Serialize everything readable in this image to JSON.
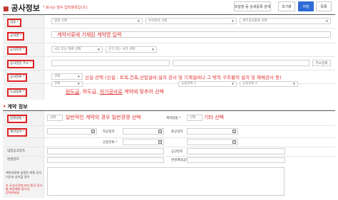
{
  "header": {
    "title": "공사정보",
    "required_note": "* 표시는 필수 입력항목입니다.",
    "buttons": {
      "search_prev": "조달청 등 상세등록 검색",
      "reset": "초기화",
      "save": "저장",
      "list": "목록"
    }
  },
  "construction": {
    "rows": {
      "work_type": {
        "label": "업종 *",
        "select": "업종 선택",
        "select2": "수의분야 선택",
        "select3": "세부공사종류 선택"
      },
      "name": {
        "label": "공사명 *",
        "annotation": "계약서류에 기재된 계약명 입력"
      },
      "location": {
        "label": "공사지역 *",
        "select": "시도 또는 대륙 선택",
        "select2": "군구 또는 국가 선택"
      },
      "address": {
        "label": "공사현장 주소 *",
        "search_btn": "주소검색"
      },
      "category": {
        "label": "공사분류 *",
        "select": "선택",
        "annotation": "신설 선택 (신설 : 토목,건축,산업설비,설치 공사 및 기계설비나 그 밖의 구조물의 설치 및 해체공사 등)"
      },
      "contract_kind": {
        "label": "도급종류 *",
        "select": "선택",
        "select2": "공종분류 1",
        "select3": "공종분류 2",
        "annotation_parts": [
          "원도급",
          ", 하도급, ",
          "자기공사로",
          " 계약에 맞추어 선택"
        ]
      }
    }
  },
  "contract": {
    "section_title": "계약 정보",
    "method": {
      "label": "입찰방법 *",
      "select": "선택",
      "annotation": "일반적인 계약의 경우 일반경쟁 선택"
    },
    "type": {
      "label": "계약방법 *",
      "select": "선택",
      "annotation": "기타 선택"
    },
    "rows": [
      {
        "left_label": "계약일자 *",
        "mid_label": "착공일자",
        "right_label": "준공일자"
      },
      {
        "left_label": "",
        "mid_label": "공종분류 *",
        "right_label": ""
      },
      {
        "left_label": "입찰공고일자",
        "mid_label": "공고번호",
        "right_label": ""
      },
      {
        "left_label": "변경일자",
        "mid_label": "변경계약금액",
        "right_label": ""
      },
      {
        "left_label": "비고",
        "mid_label": "비고",
        "right_label": ""
      }
    ],
    "memo": {
      "line1": "계약서류에 설정된 최종 공사기간과 상이할 경우",
      "line2": "※ 공사기간에 따라 중간 공사를 포함해야 합니다",
      "line3": "입력하세요"
    }
  },
  "colors": {
    "accent": "#2e6bd6",
    "annotation": "#e03030",
    "label_bg": "#f3f3f3"
  }
}
